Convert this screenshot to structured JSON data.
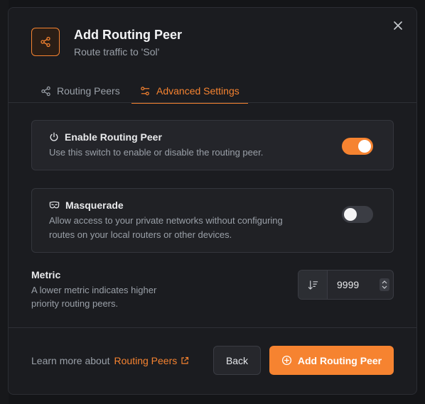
{
  "dialog": {
    "title": "Add Routing Peer",
    "subtitle": "Route traffic to 'Sol'",
    "header_icon": "share-icon",
    "close_icon": "close-icon"
  },
  "tabs": [
    {
      "label": "Routing Peers",
      "icon": "share-icon",
      "active": false
    },
    {
      "label": "Advanced Settings",
      "icon": "sliders-icon",
      "active": true
    }
  ],
  "settings": {
    "enable": {
      "title": "Enable Routing Peer",
      "description": "Use this switch to enable or disable the routing peer.",
      "icon": "power-icon",
      "checked": true
    },
    "masquerade": {
      "title": "Masquerade",
      "description_line1": "Allow access to your private networks without configuring",
      "description_line2": "routes on your local routers or other devices.",
      "icon": "mask-icon",
      "checked": false
    }
  },
  "metric": {
    "label": "Metric",
    "description_line1": "A lower metric indicates higher",
    "description_line2": "priority routing peers.",
    "value": "9999",
    "prefix_icon": "sort-descending-icon"
  },
  "footer": {
    "learn_prefix": "Learn more about",
    "learn_link": "Routing Peers",
    "back_label": "Back",
    "submit_label": "Add Routing Peer"
  },
  "colors": {
    "accent": "#f68330",
    "background": "#1b1c20",
    "card": "#24252a"
  }
}
